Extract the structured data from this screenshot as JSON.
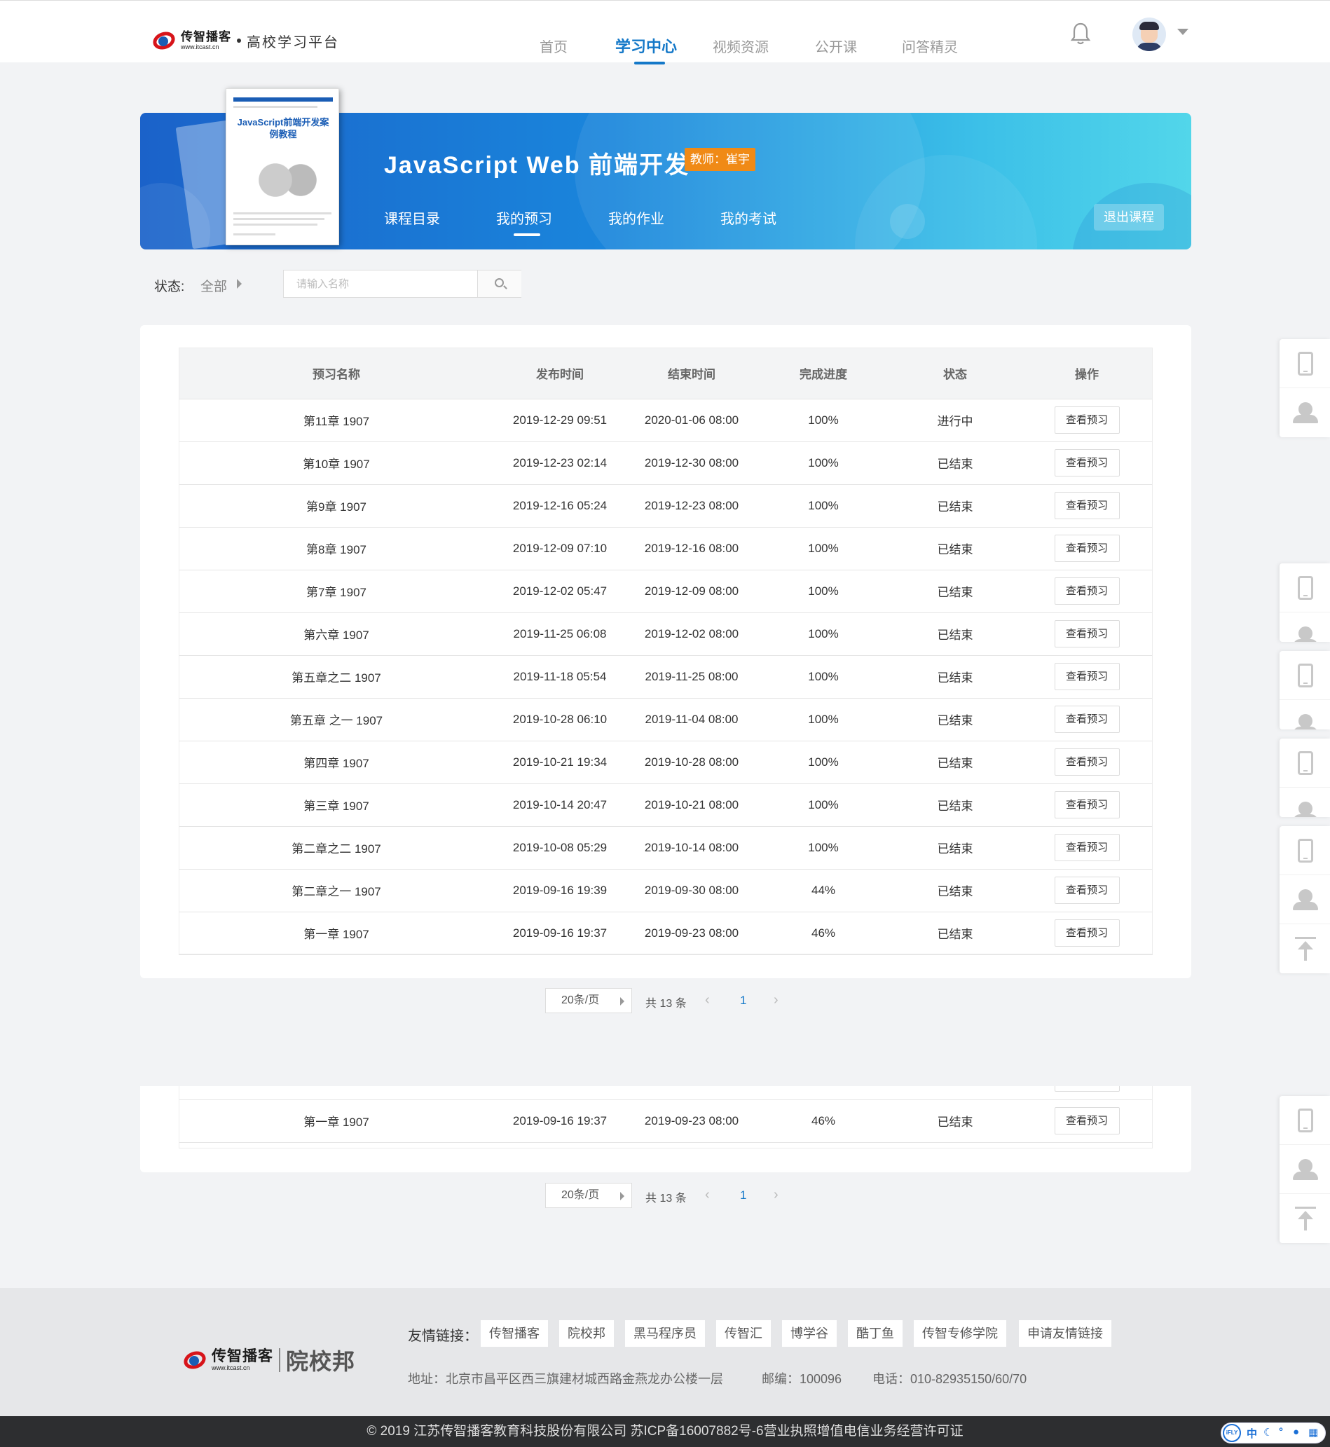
{
  "header": {
    "logo_cn": "传智播客",
    "logo_en": "www.itcast.cn",
    "platform": "高校学习平台",
    "nav": [
      "首页",
      "学习中心",
      "视频资源",
      "公开课",
      "问答精灵"
    ],
    "active_nav": "学习中心"
  },
  "banner": {
    "book_title": "JavaScript前端开发案例教程",
    "course_title": "JavaScript Web 前端开发",
    "teacher": "教师：崔宇",
    "tabs": [
      "课程目录",
      "我的预习",
      "我的作业",
      "我的考试"
    ],
    "active_tab": "我的预习",
    "exit": "退出课程"
  },
  "filter": {
    "label": "状态:",
    "value": "全部",
    "search_placeholder": "请输入名称"
  },
  "table": {
    "columns": [
      "预习名称",
      "发布时间",
      "结束时间",
      "完成进度",
      "状态",
      "操作"
    ],
    "rows": [
      {
        "name": "第11章 1907",
        "publish": "2019-12-29 09:51",
        "end": "2020-01-06 08:00",
        "progress": "100%",
        "status": "进行中",
        "action": "查看预习"
      },
      {
        "name": "第10章 1907",
        "publish": "2019-12-23 02:14",
        "end": "2019-12-30 08:00",
        "progress": "100%",
        "status": "已结束",
        "action": "查看预习"
      },
      {
        "name": "第9章 1907",
        "publish": "2019-12-16 05:24",
        "end": "2019-12-23 08:00",
        "progress": "100%",
        "status": "已结束",
        "action": "查看预习"
      },
      {
        "name": "第8章 1907",
        "publish": "2019-12-09 07:10",
        "end": "2019-12-16 08:00",
        "progress": "100%",
        "status": "已结束",
        "action": "查看预习"
      },
      {
        "name": "第7章 1907",
        "publish": "2019-12-02 05:47",
        "end": "2019-12-09 08:00",
        "progress": "100%",
        "status": "已结束",
        "action": "查看预习"
      },
      {
        "name": "第六章 1907",
        "publish": "2019-11-25 06:08",
        "end": "2019-12-02 08:00",
        "progress": "100%",
        "status": "已结束",
        "action": "查看预习"
      },
      {
        "name": "第五章之二 1907",
        "publish": "2019-11-18 05:54",
        "end": "2019-11-25 08:00",
        "progress": "100%",
        "status": "已结束",
        "action": "查看预习"
      },
      {
        "name": "第五章 之一 1907",
        "publish": "2019-10-28 06:10",
        "end": "2019-11-04 08:00",
        "progress": "100%",
        "status": "已结束",
        "action": "查看预习"
      },
      {
        "name": "第四章 1907",
        "publish": "2019-10-21 19:34",
        "end": "2019-10-28 08:00",
        "progress": "100%",
        "status": "已结束",
        "action": "查看预习"
      },
      {
        "name": "第三章 1907",
        "publish": "2019-10-14 20:47",
        "end": "2019-10-21 08:00",
        "progress": "100%",
        "status": "已结束",
        "action": "查看预习"
      },
      {
        "name": "第二章之二 1907",
        "publish": "2019-10-08 05:29",
        "end": "2019-10-14 08:00",
        "progress": "100%",
        "status": "已结束",
        "action": "查看预习"
      },
      {
        "name": "第二章之一 1907",
        "publish": "2019-09-16 19:39",
        "end": "2019-09-30 08:00",
        "progress": "44%",
        "status": "已结束",
        "action": "查看预习"
      },
      {
        "name": "第一章 1907",
        "publish": "2019-09-16 19:37",
        "end": "2019-09-23 08:00",
        "progress": "46%",
        "status": "已结束",
        "action": "查看预习"
      }
    ]
  },
  "pager": {
    "page_size": "20条/页",
    "total": "共 13 条",
    "prev": "‹",
    "current": "1",
    "next": "›"
  },
  "footer": {
    "links_label": "友情链接：",
    "links": [
      "传智播客",
      "院校邦",
      "黑马程序员",
      "传智汇",
      "博学谷",
      "酷丁鱼",
      "传智专修学院",
      "申请友情链接"
    ],
    "address": "地址：北京市昌平区西三旗建材城西路金燕龙办公楼一层",
    "postcode": "邮编：100096",
    "phone": "电话：010-82935150/60/70",
    "logo_cn": "传智播客",
    "logo_en": "www.itcast.cn",
    "logo_partner": "院校邦",
    "copyright": "© 2019 江苏传智播客教育科技股份有限公司    苏ICP备16007882号-6营业执照增值电信业务经营许可证"
  },
  "ime": {
    "brand": "iFLY",
    "lang": "中"
  },
  "colors": {
    "primary": "#1478c8",
    "tag_orange": "#f08a16",
    "banner_start": "#1b62c9",
    "banner_end": "#52d6ea",
    "footer_bg": "#e6e7e9",
    "copyright_bg": "#2d2e30"
  }
}
